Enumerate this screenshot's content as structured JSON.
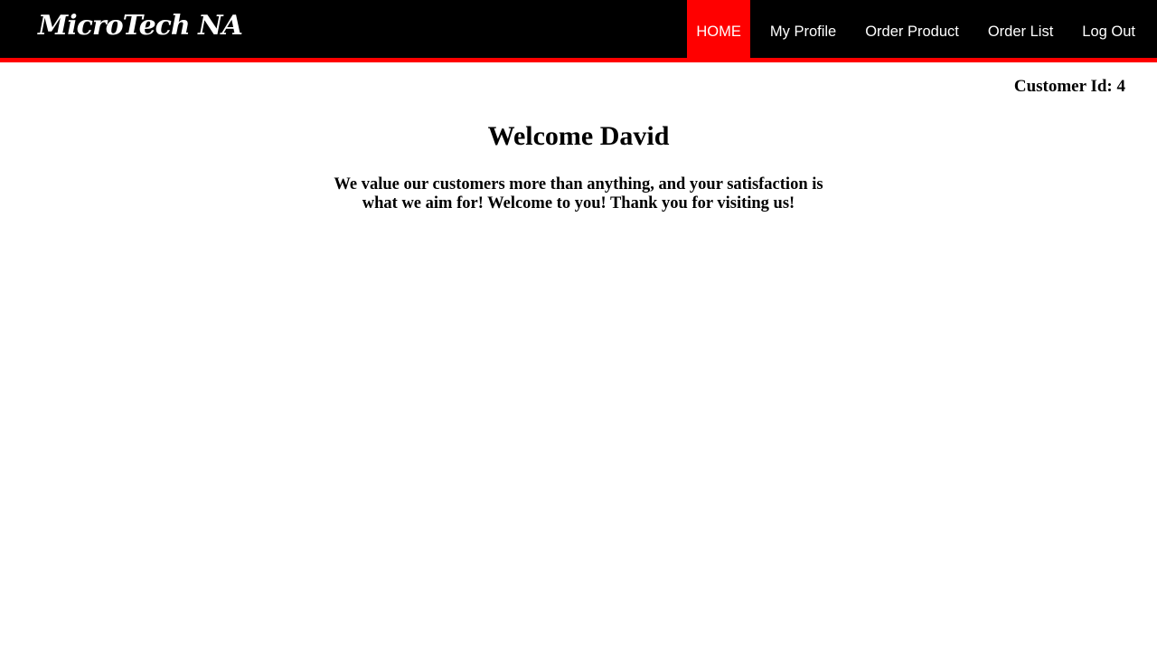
{
  "header": {
    "brand": "MicroTech NA",
    "nav": [
      {
        "label": "HOME",
        "active": true
      },
      {
        "label": "My Profile",
        "active": false
      },
      {
        "label": "Order Product",
        "active": false
      },
      {
        "label": "Order List",
        "active": false
      },
      {
        "label": "Log Out",
        "active": false
      }
    ]
  },
  "main": {
    "customer_id_label": "Customer Id:",
    "customer_id": "4",
    "welcome_prefix": "Welcome",
    "user_name": "David",
    "tagline": "We value our customers more than anything, and your satisfaction is what we aim for! Welcome to you! Thank you for visiting us!"
  },
  "colors": {
    "navbar_bg": "#000000",
    "accent": "#ff0000",
    "text": "#000000",
    "nav_text": "#ffffff"
  }
}
